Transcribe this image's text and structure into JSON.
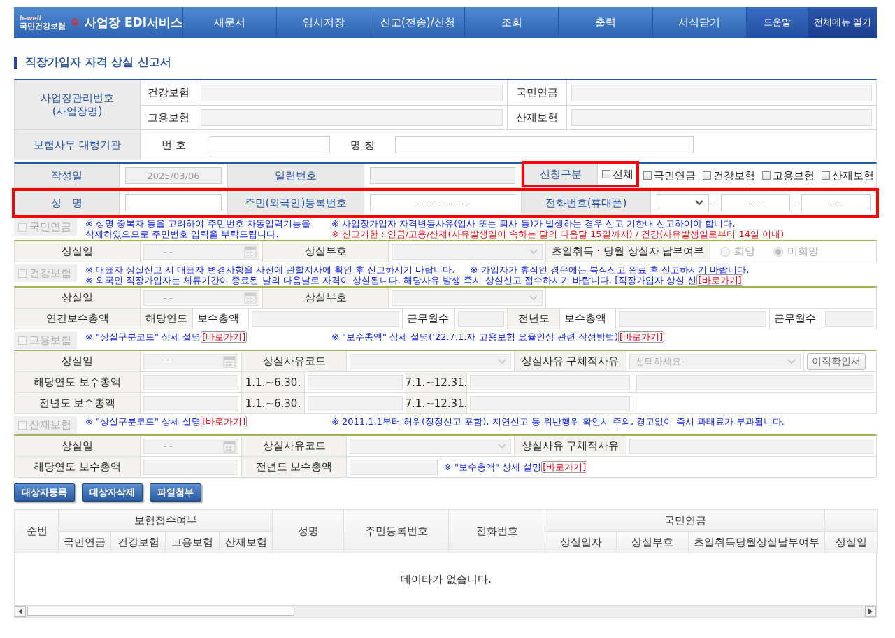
{
  "header": {
    "logo_tagline": "h-well",
    "logo_name": "국민건강보험",
    "service_title": "사업장 EDI서비스",
    "menu": [
      {
        "label": "새문서",
        "kind": "main"
      },
      {
        "label": "임시저장",
        "kind": "main"
      },
      {
        "label": "신고(전송)/신청",
        "kind": "main"
      },
      {
        "label": "조회",
        "kind": "main"
      },
      {
        "label": "출력",
        "kind": "main"
      },
      {
        "label": "서식닫기",
        "kind": "main"
      },
      {
        "label": "도움말",
        "kind": "help"
      },
      {
        "label": "전체메뉴 열기",
        "kind": "all"
      }
    ]
  },
  "page_title": "직장가입자 자격 상실 신고서",
  "business": {
    "label_lines": [
      "사업장관리번호",
      "(사업장명)"
    ],
    "numbers": [
      {
        "left_label": "건강보험",
        "right_label": "국민연금"
      },
      {
        "left_label": "고용보험",
        "right_label": "산재보험"
      }
    ],
    "agency_label": "보험사무 대행기관",
    "agency_number_label": "번 호",
    "agency_name_label": "명 칭"
  },
  "report": {
    "date_label": "작성일",
    "date_value": "2025/03/06",
    "serial_label": "일련번호",
    "apply_label": "신청구분",
    "apply_highlight": true,
    "apply_options": [
      {
        "label": "전체",
        "checked": false
      },
      {
        "label": "국민연금",
        "checked": false
      },
      {
        "label": "건강보험",
        "checked": false
      },
      {
        "label": "고용보험",
        "checked": false
      },
      {
        "label": "산재보험",
        "checked": false
      }
    ],
    "person_highlight": true,
    "name_label": "성   명",
    "rrn_label": "주민(외국인)등록번호",
    "rrn_value": "------ - -------",
    "phone_label": "전화번호(휴대폰)",
    "phone_separators": [
      "-",
      "-"
    ],
    "phone_values": [
      "----",
      "----"
    ]
  },
  "sections": [
    {
      "kind": "pension",
      "title": "국민연금",
      "checked": false,
      "disabled": true,
      "notes": [
        [
          {
            "paragraphs": [
              {
                "text": "※ 성명 중복자 등을 고려하여 주민번호 자동입력기능을 삭제하였으므로 주민번호 입력을 부탁드립니다.",
                "color": "#0b24e8"
              }
            ]
          },
          {
            "paragraphs": [
              {
                "text": "※ 사업장가입자 자격변동사유(입사 또는 퇴사 등)가 발생하는 경우 신고 기한내 신고하여야 합니다.",
                "color": "#0b24e8"
              },
              {
                "text": "※ 신고기한 : 연금/고용/산재(사유발생일이 속하는 달의 다음달 15일까지) / 건강(사유발생일로부터 14일 이내)",
                "color": "#e8101b"
              }
            ]
          }
        ]
      ],
      "rows": [
        [
          {
            "kind": "label",
            "text": "상실일"
          },
          {
            "kind": "date",
            "value": "- -"
          },
          {
            "kind": "label",
            "text": "상실부호"
          },
          {
            "kind": "select"
          },
          {
            "kind": "label",
            "text": "초일취득 · 당월 상실자 납부여부"
          },
          {
            "kind": "radio",
            "disabled": true,
            "options": [
              {
                "label": "희망",
                "selected": false
              },
              {
                "label": "미희망",
                "selected": true
              }
            ]
          }
        ]
      ]
    },
    {
      "kind": "health",
      "title": "건강보험",
      "checked": false,
      "disabled": true,
      "notes": [
        [
          {
            "paragraphs": [
              {
                "text": "※ 대표자 상실신고 시 대표자 변경사항을 사전에 관할지사에 확인 후 신고하시기 바랍니다.",
                "color": "#0b24e8"
              }
            ]
          },
          {
            "paragraphs": [
              {
                "text": "※ 가입자가 휴직인 경우에는 복직신고 완료 후 신고하시기 바랍니다.",
                "color": "#0b24e8"
              }
            ]
          }
        ],
        [
          {
            "paragraphs": [
              {
                "text": "※ 외국인 직장가입자는 체류기간이 종료된 날의 다음날로 자격이 상실됩니다. 해당사유 발생 즉시 상실신고 접수하시기 바랍니다. [직장가입자 상실 신",
                "color": "#0b24e8",
                "link": "[바로가기]"
              }
            ]
          }
        ]
      ],
      "rows": [
        [
          {
            "kind": "label",
            "text": "상실일"
          },
          {
            "kind": "date",
            "value": "- -"
          },
          {
            "kind": "label",
            "text": "상실부호"
          },
          {
            "kind": "select"
          }
        ],
        [
          {
            "kind": "label",
            "text": "연간보수총액"
          },
          {
            "kind": "label",
            "text": "해당연도"
          },
          {
            "kind": "text",
            "text": "보수총액"
          },
          {
            "kind": "input"
          },
          {
            "kind": "text",
            "text": "근무월수"
          },
          {
            "kind": "input"
          },
          {
            "kind": "label",
            "text": "전년도"
          },
          {
            "kind": "text",
            "text": "보수총액"
          },
          {
            "kind": "input"
          },
          {
            "kind": "text",
            "text": "근무월수"
          },
          {
            "kind": "input"
          }
        ]
      ]
    },
    {
      "kind": "employment",
      "title": "고용보험",
      "checked": false,
      "disabled": true,
      "notes": [
        [
          {
            "paragraphs": [
              {
                "text": "※ \"상실구분코드\" 상세 설명",
                "color": "#0b24e8",
                "link": "[바로가기]"
              }
            ]
          },
          {
            "paragraphs": [
              {
                "text": "※ \"보수총액\" 상세 설명('22.7.1.자 고용보험 요율인상 관련 작성방법)",
                "color": "#0b24e8",
                "link": "[바로가기]"
              }
            ]
          }
        ]
      ],
      "rows": [
        [
          {
            "kind": "label",
            "text": "상실일"
          },
          {
            "kind": "date",
            "value": "- -"
          },
          {
            "kind": "label",
            "text": "상실사유코드"
          },
          {
            "kind": "select"
          },
          {
            "kind": "label",
            "text": "상실사유 구체적사유"
          },
          {
            "kind": "select",
            "placeholder": "-선택하세요-"
          },
          {
            "kind": "button",
            "text": "이직확인서"
          }
        ],
        [
          {
            "kind": "label",
            "text": "해당연도 보수총액"
          },
          {
            "kind": "input"
          },
          {
            "kind": "label",
            "text": "1.1.~6.30."
          },
          {
            "kind": "input"
          },
          {
            "kind": "label",
            "text": "7.1.~12.31."
          },
          {
            "kind": "input"
          },
          {
            "kind": "input"
          }
        ],
        [
          {
            "kind": "label",
            "text": "전년도 보수총액"
          },
          {
            "kind": "input"
          },
          {
            "kind": "label",
            "text": "1.1.~6.30."
          },
          {
            "kind": "input"
          },
          {
            "kind": "label",
            "text": "7.1.~12.31."
          },
          {
            "kind": "input"
          }
        ]
      ]
    },
    {
      "kind": "accident",
      "title": "산재보험",
      "checked": false,
      "disabled": true,
      "notes": [
        [
          {
            "paragraphs": [
              {
                "text": "※ \"상실구분코드\" 상세 설명",
                "color": "#0b24e8",
                "link": "[바로가기]"
              }
            ]
          },
          {
            "paragraphs": [
              {
                "text": "※ 2011.1.1부터 허위(정정신고 포함), 지연신고 등 위반행위 확인시 주의, 경고없이 즉시 과태료가 부과됩니다.",
                "color": "#0b24e8"
              }
            ]
          }
        ]
      ],
      "rows": [
        [
          {
            "kind": "label",
            "text": "상실일"
          },
          {
            "kind": "date",
            "value": "- -"
          },
          {
            "kind": "label",
            "text": "상실사유코드"
          },
          {
            "kind": "select"
          },
          {
            "kind": "label",
            "text": "상실사유 구체적사유"
          },
          {
            "kind": "input"
          }
        ],
        [
          {
            "kind": "label",
            "text": "해당연도 보수총액"
          },
          {
            "kind": "input"
          },
          {
            "kind": "label",
            "text": "전년도 보수총액"
          },
          {
            "kind": "input"
          },
          {
            "kind": "note",
            "text": "※ \"보수총액\" 상세 설명",
            "color": "#0b24e8",
            "link": "[바로가기]"
          }
        ]
      ]
    }
  ],
  "actions": [
    "대상자등록",
    "대상자삭제",
    "파일첨부"
  ],
  "results": {
    "columns": [
      {
        "label": "순번"
      },
      {
        "label": "보험접수여부",
        "children": [
          {
            "label": "국민연금"
          },
          {
            "label": "건강보험"
          },
          {
            "label": "고용보험"
          },
          {
            "label": "산재보험"
          }
        ]
      },
      {
        "label": "성명"
      },
      {
        "label": "주민등록번호"
      },
      {
        "label": "전화번호"
      },
      {
        "label": "국민연금",
        "children": [
          {
            "label": "상실일자"
          },
          {
            "label": "상실부호"
          },
          {
            "label": "초일취득당월상실납부여부"
          }
        ]
      },
      {
        "children": [
          {
            "label": "상실일"
          }
        ]
      }
    ],
    "empty_message": "데이타가 없습니다."
  }
}
